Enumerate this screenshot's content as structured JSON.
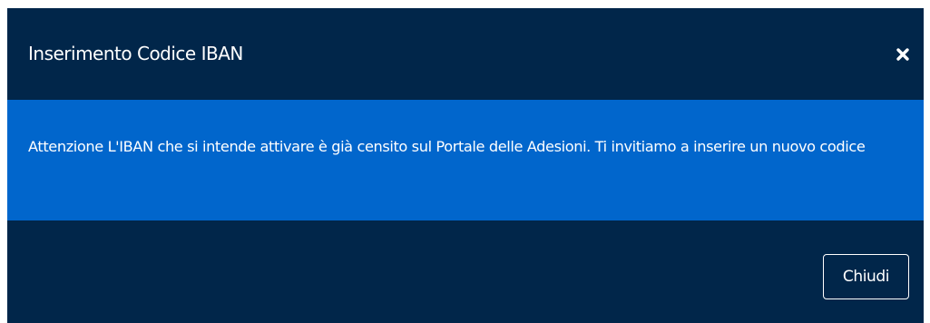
{
  "modal": {
    "title": "Inserimento Codice IBAN",
    "close_icon": "close-icon",
    "alert_message": "Attenzione L'IBAN che si intende attivare è già censito sul Portale delle Adesioni. Ti invitiamo a inserire un nuovo codice",
    "close_button_label": "Chiudi",
    "colors": {
      "background": "#01264a",
      "alert": "#0166cc",
      "text": "#ffffff"
    }
  }
}
